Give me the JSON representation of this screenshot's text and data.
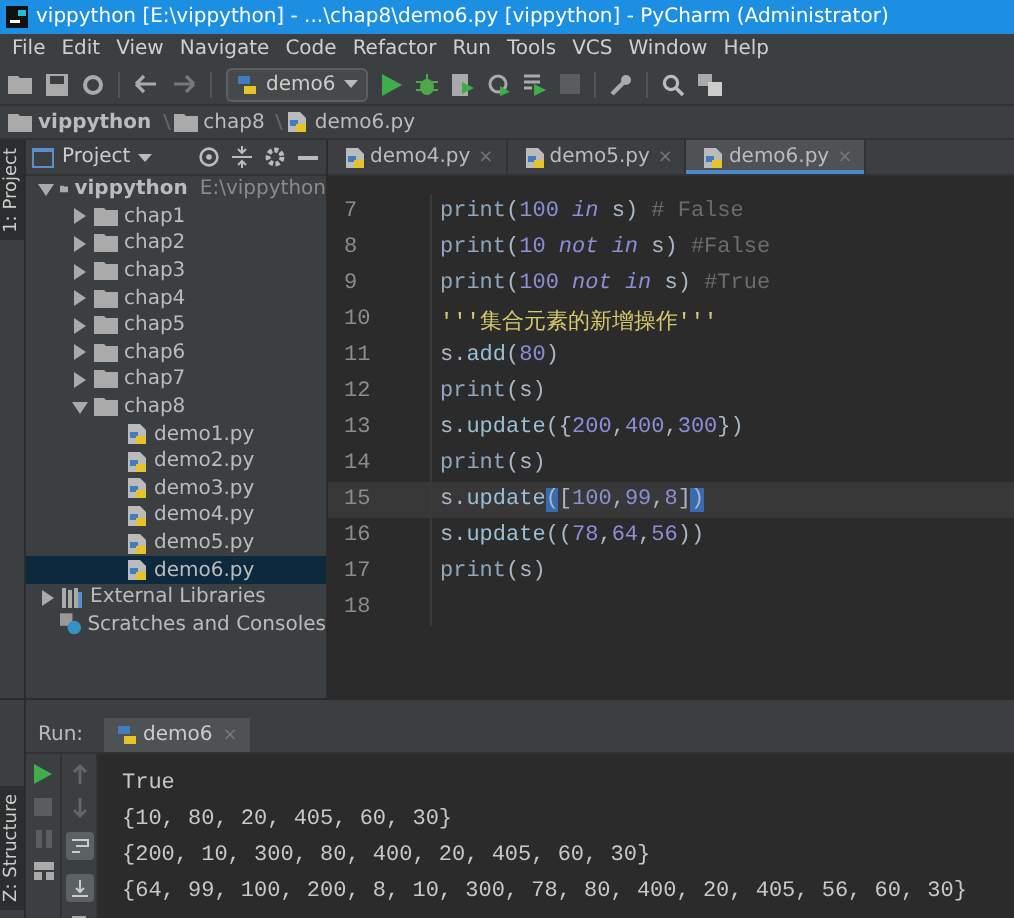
{
  "window": {
    "title": "vippython [E:\\vippython] - ...\\chap8\\demo6.py [vippython] - PyCharm (Administrator)"
  },
  "menu": [
    "File",
    "Edit",
    "View",
    "Navigate",
    "Code",
    "Refactor",
    "Run",
    "Tools",
    "VCS",
    "Window",
    "Help"
  ],
  "toolbar": {
    "run_config": "demo6"
  },
  "breadcrumb": [
    "vippython",
    "chap8",
    "demo6.py"
  ],
  "side_stripe": {
    "label": "1: Project"
  },
  "project_panel": {
    "title": "Project",
    "tree": [
      {
        "label": "vippython",
        "note": "E:\\vippython",
        "kind": "module",
        "expanded": true,
        "children": [
          {
            "label": "chap1",
            "kind": "folder",
            "expanded": false
          },
          {
            "label": "chap2",
            "kind": "folder",
            "expanded": false
          },
          {
            "label": "chap3",
            "kind": "folder",
            "expanded": false
          },
          {
            "label": "chap4",
            "kind": "folder",
            "expanded": false
          },
          {
            "label": "chap5",
            "kind": "folder",
            "expanded": false
          },
          {
            "label": "chap6",
            "kind": "folder",
            "expanded": false
          },
          {
            "label": "chap7",
            "kind": "folder",
            "expanded": false
          },
          {
            "label": "chap8",
            "kind": "folder",
            "expanded": true,
            "children": [
              {
                "label": "demo1.py",
                "kind": "file",
                "selected": false
              },
              {
                "label": "demo2.py",
                "kind": "file",
                "selected": false
              },
              {
                "label": "demo3.py",
                "kind": "file",
                "selected": false
              },
              {
                "label": "demo4.py",
                "kind": "file",
                "selected": false
              },
              {
                "label": "demo5.py",
                "kind": "file",
                "selected": false
              },
              {
                "label": "demo6.py",
                "kind": "file",
                "selected": true
              }
            ]
          }
        ]
      },
      {
        "label": "External Libraries",
        "kind": "library",
        "expanded": false
      },
      {
        "label": "Scratches and Consoles",
        "kind": "scratches"
      }
    ]
  },
  "editor": {
    "tabs": [
      {
        "label": "demo4.py",
        "close": "×",
        "selected": false
      },
      {
        "label": "demo5.py",
        "close": "×",
        "selected": false
      },
      {
        "label": "demo6.py",
        "close": "×",
        "selected": true
      }
    ],
    "lines": [
      {
        "number": "7",
        "current": false,
        "tokens": [
          {
            "text": "print",
            "kind": "builtin"
          },
          {
            "text": "(",
            "kind": "plain"
          },
          {
            "text": "100",
            "kind": "number"
          },
          {
            "text": " in",
            "kind": "keyword"
          },
          {
            "text": " s) ",
            "kind": "plain"
          },
          {
            "text": "# False",
            "kind": "comment"
          }
        ]
      },
      {
        "number": "8",
        "current": false,
        "tokens": [
          {
            "text": "print",
            "kind": "builtin"
          },
          {
            "text": "(",
            "kind": "plain"
          },
          {
            "text": "10",
            "kind": "number"
          },
          {
            "text": " not in",
            "kind": "keyword"
          },
          {
            "text": " s) ",
            "kind": "plain"
          },
          {
            "text": "#False",
            "kind": "comment"
          }
        ]
      },
      {
        "number": "9",
        "current": false,
        "tokens": [
          {
            "text": "print",
            "kind": "builtin"
          },
          {
            "text": "(",
            "kind": "plain"
          },
          {
            "text": "100",
            "kind": "number"
          },
          {
            "text": " not in",
            "kind": "keyword"
          },
          {
            "text": " s) ",
            "kind": "plain"
          },
          {
            "text": "#True",
            "kind": "comment"
          }
        ]
      },
      {
        "number": "10",
        "current": false,
        "tokens": [
          {
            "text": "'''集合元素的新增操作'''",
            "kind": "string"
          }
        ]
      },
      {
        "number": "11",
        "current": false,
        "tokens": [
          {
            "text": "s.",
            "kind": "plain"
          },
          {
            "text": "add",
            "kind": "method"
          },
          {
            "text": "(",
            "kind": "plain"
          },
          {
            "text": "80",
            "kind": "number"
          },
          {
            "text": ")",
            "kind": "plain"
          }
        ]
      },
      {
        "number": "12",
        "current": false,
        "tokens": [
          {
            "text": "print",
            "kind": "builtin"
          },
          {
            "text": "(s)",
            "kind": "plain"
          }
        ]
      },
      {
        "number": "13",
        "current": false,
        "tokens": [
          {
            "text": "s.",
            "kind": "plain"
          },
          {
            "text": "update",
            "kind": "method"
          },
          {
            "text": "({",
            "kind": "plain"
          },
          {
            "text": "200",
            "kind": "number"
          },
          {
            "text": ",",
            "kind": "plain"
          },
          {
            "text": "400",
            "kind": "number"
          },
          {
            "text": ",",
            "kind": "plain"
          },
          {
            "text": "300",
            "kind": "number"
          },
          {
            "text": "})",
            "kind": "plain"
          }
        ]
      },
      {
        "number": "14",
        "current": false,
        "tokens": [
          {
            "text": "print",
            "kind": "builtin"
          },
          {
            "text": "(s)",
            "kind": "plain"
          }
        ]
      },
      {
        "number": "15",
        "current": true,
        "tokens": [
          {
            "text": "s.",
            "kind": "plain"
          },
          {
            "text": "update",
            "kind": "method"
          },
          {
            "text": "(",
            "kind": "match"
          },
          {
            "text": "[",
            "kind": "plain"
          },
          {
            "text": "100",
            "kind": "number"
          },
          {
            "text": ",",
            "kind": "plain"
          },
          {
            "text": "99",
            "kind": "number"
          },
          {
            "text": ",",
            "kind": "plain"
          },
          {
            "text": "8",
            "kind": "number"
          },
          {
            "text": "]",
            "kind": "plain"
          },
          {
            "text": ")",
            "kind": "match"
          }
        ]
      },
      {
        "number": "16",
        "current": false,
        "tokens": [
          {
            "text": "s.",
            "kind": "plain"
          },
          {
            "text": "update",
            "kind": "method"
          },
          {
            "text": "((",
            "kind": "plain"
          },
          {
            "text": "78",
            "kind": "number"
          },
          {
            "text": ",",
            "kind": "plain"
          },
          {
            "text": "64",
            "kind": "number"
          },
          {
            "text": ",",
            "kind": "plain"
          },
          {
            "text": "56",
            "kind": "number"
          },
          {
            "text": "))",
            "kind": "plain"
          }
        ]
      },
      {
        "number": "17",
        "current": false,
        "tokens": [
          {
            "text": "print",
            "kind": "builtin"
          },
          {
            "text": "(s)",
            "kind": "plain"
          }
        ]
      },
      {
        "number": "18",
        "current": false
      }
    ]
  },
  "run_panel": {
    "label": "Run:",
    "tab": "demo6",
    "close": "×",
    "output": [
      "True",
      "{10, 80, 20, 405, 60, 30}",
      "{200, 10, 300, 80, 400, 20, 405, 60, 30}",
      "{64, 99, 100, 200, 8, 10, 300, 78, 80, 400, 20, 405, 56, 60, 30}"
    ]
  },
  "bottom_stripe": {
    "label": "Z: Structure"
  }
}
